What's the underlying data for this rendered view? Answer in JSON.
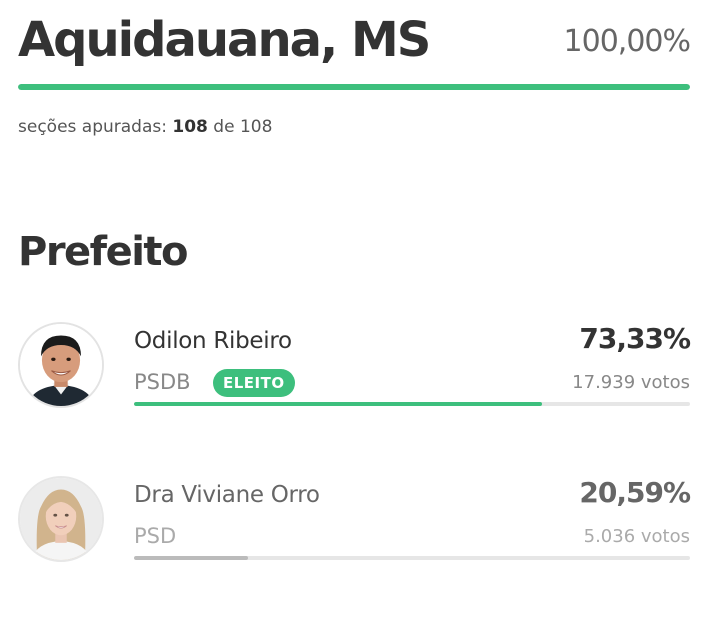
{
  "city": {
    "name": "Aquidauana, MS",
    "percent_counted": "100,00%",
    "progress_fraction": 1.0
  },
  "sections": {
    "label": "seções apuradas:",
    "counted": "108",
    "connector": "de",
    "total": "108"
  },
  "office": {
    "title": "Prefeito"
  },
  "candidates": [
    {
      "name": "Odilon Ribeiro",
      "party": "PSDB",
      "badge": "ELEITO",
      "percent": "73,33%",
      "votes": "17.939 votos",
      "share": 0.7333,
      "bar_color": "#3dbf7d"
    },
    {
      "name": "Dra Viviane Orro",
      "party": "PSD",
      "percent": "20,59%",
      "votes": "5.036 votos",
      "share": 0.2059,
      "bar_color": "#bbbbbb"
    }
  ],
  "colors": {
    "accent": "#3dbf7d",
    "track": "#e6e6e6",
    "text": "#333333"
  }
}
